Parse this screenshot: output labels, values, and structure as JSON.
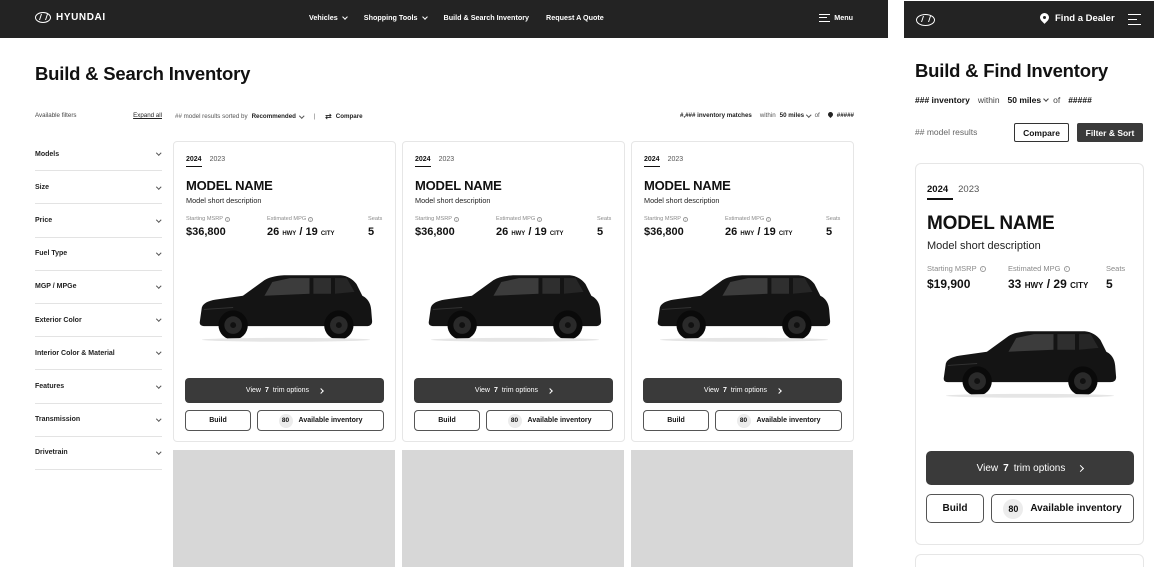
{
  "desktop": {
    "nav": {
      "logo": "HYUNDAI",
      "links": [
        {
          "label": "Vehicles",
          "dropdown": true
        },
        {
          "label": "Shopping Tools",
          "dropdown": true
        },
        {
          "label": "Build & Search Inventory",
          "dropdown": false
        },
        {
          "label": "Request A Quote",
          "dropdown": false
        }
      ],
      "menu_label": "Menu"
    },
    "page_title": "Build & Search Inventory",
    "filters": {
      "heading": "Available filters",
      "expand_all": "Expand all",
      "items": [
        "Models",
        "Size",
        "Price",
        "Fuel Type",
        "MGP / MPGe",
        "Exterior Color",
        "Interior Color & Material",
        "Features",
        "Transmission",
        "Drivetrain"
      ]
    },
    "results_bar": {
      "count_text": "## model results sorted by",
      "sort_value": "Recommended",
      "divider": "|",
      "compare": "Compare"
    },
    "matches_bar": {
      "count_text": "#,### inventory matches",
      "within": "within",
      "distance": "50 miles",
      "of": "of",
      "zip": "#####"
    },
    "cards": [
      {
        "year_active": "2024",
        "year_other": "2023",
        "model_name": "MODEL NAME",
        "model_desc": "Model short description",
        "msrp_label": "Starting MSRP",
        "msrp": "$36,800",
        "mpg_label": "Estimated MPG",
        "mpg_hwy": "26",
        "hwy": "HWY",
        "slash": "/",
        "mpg_city": "19",
        "city": "CITY",
        "seats_label": "Seats",
        "seats": "5",
        "trim_prefix": "View",
        "trim_count": "7",
        "trim_suffix": "trim options",
        "build": "Build",
        "inv_count": "80",
        "inv_label": "Available inventory"
      },
      {
        "year_active": "2024",
        "year_other": "2023",
        "model_name": "MODEL NAME",
        "model_desc": "Model short description",
        "msrp_label": "Starting MSRP",
        "msrp": "$36,800",
        "mpg_label": "Estimated MPG",
        "mpg_hwy": "26",
        "hwy": "HWY",
        "slash": "/",
        "mpg_city": "19",
        "city": "CITY",
        "seats_label": "Seats",
        "seats": "5",
        "trim_prefix": "View",
        "trim_count": "7",
        "trim_suffix": "trim options",
        "build": "Build",
        "inv_count": "80",
        "inv_label": "Available inventory"
      },
      {
        "year_active": "2024",
        "year_other": "2023",
        "model_name": "MODEL NAME",
        "model_desc": "Model short description",
        "msrp_label": "Starting MSRP",
        "msrp": "$36,800",
        "mpg_label": "Estimated MPG",
        "mpg_hwy": "26",
        "hwy": "HWY",
        "slash": "/",
        "mpg_city": "19",
        "city": "CITY",
        "seats_label": "Seats",
        "seats": "5",
        "trim_prefix": "View",
        "trim_count": "7",
        "trim_suffix": "trim options",
        "build": "Build",
        "inv_count": "80",
        "inv_label": "Available inventory"
      }
    ]
  },
  "mobile": {
    "find_dealer": "Find a Dealer",
    "page_title": "Build & Find Inventory",
    "inventory_line": {
      "count": "### inventory",
      "within": "within",
      "distance": "50 miles",
      "of": "of",
      "zip": "#####"
    },
    "results": "## model results",
    "compare": "Compare",
    "filter_sort": "Filter & Sort",
    "card": {
      "year_active": "2024",
      "year_other": "2023",
      "model_name": "MODEL NAME",
      "model_desc": "Model short description",
      "msrp_label": "Starting MSRP",
      "msrp": "$19,900",
      "mpg_label": "Estimated MPG",
      "mpg_hwy": "33",
      "hwy": "HWY",
      "slash": "/",
      "mpg_city": "29",
      "city": "CITY",
      "seats_label": "Seats",
      "seats": "5",
      "trim_prefix": "View",
      "trim_count": "7",
      "trim_suffix": "trim options",
      "build": "Build",
      "inv_count": "80",
      "inv_label": "Available inventory"
    }
  },
  "colors": {
    "nav_bg": "#232323",
    "primary_button": "#3a3a3a",
    "placeholder": "#d7d7d7",
    "border": "#e6e6e6"
  },
  "icons": [
    "hyundai-logo-icon",
    "chevron-down-icon",
    "menu-icon",
    "compare-arrows-icon",
    "location-pin-icon",
    "info-icon",
    "chevron-right-icon",
    "vehicle-image"
  ]
}
